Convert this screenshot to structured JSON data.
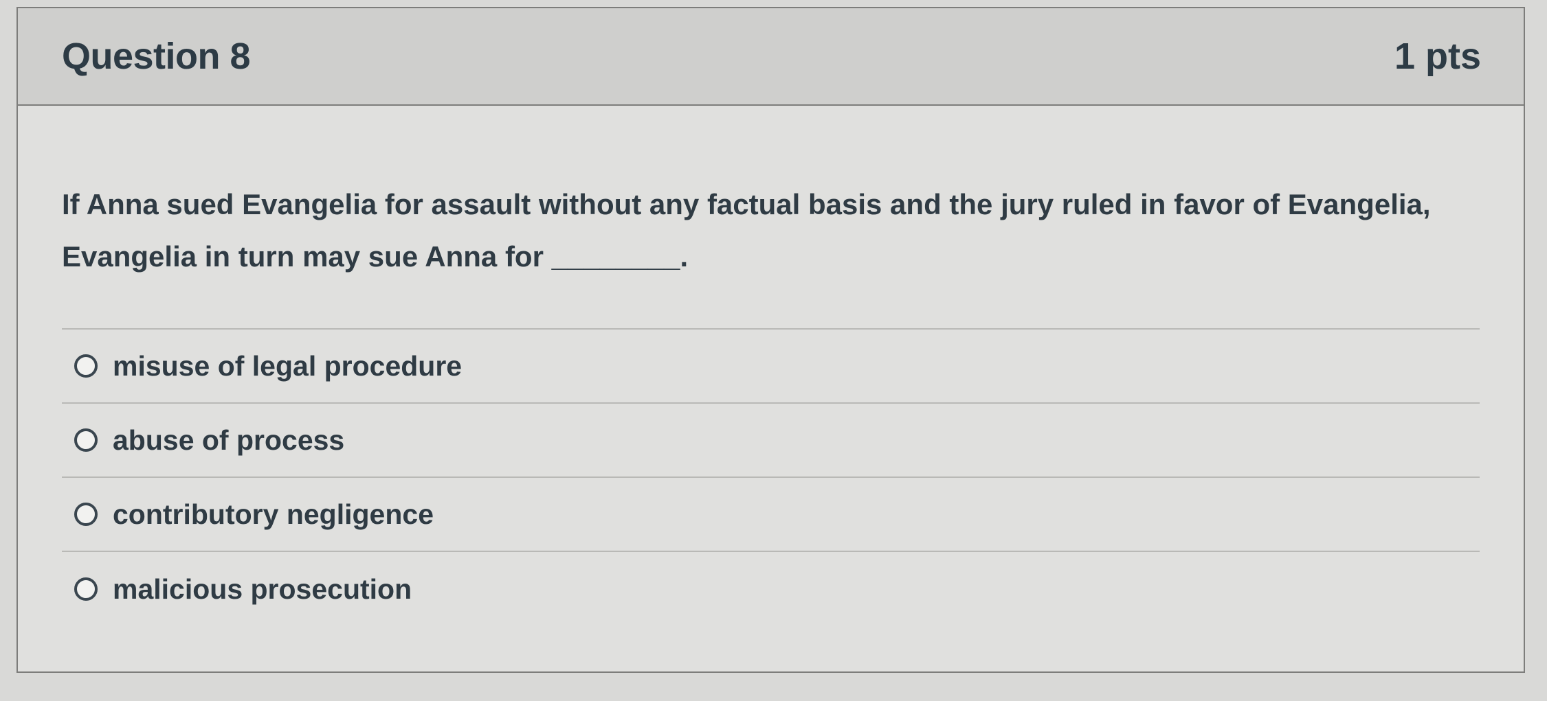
{
  "question": {
    "title": "Question 8",
    "points": "1 pts",
    "text": "If Anna sued Evangelia for assault without any factual basis and the jury ruled in favor of Evangelia, Evangelia in turn may sue Anna for ________."
  },
  "answers": [
    {
      "label": "misuse of legal procedure",
      "selected": false
    },
    {
      "label": "abuse of process",
      "selected": false
    },
    {
      "label": "contributory negligence",
      "selected": false
    },
    {
      "label": "malicious prosecution",
      "selected": false
    }
  ],
  "colors": {
    "header_background": "#cfcfcd",
    "card_background": "#e0e0de",
    "text": "#2d3b45",
    "border": "#7d7d7b"
  },
  "icons": {
    "answer_control": "radio-button-icon"
  }
}
